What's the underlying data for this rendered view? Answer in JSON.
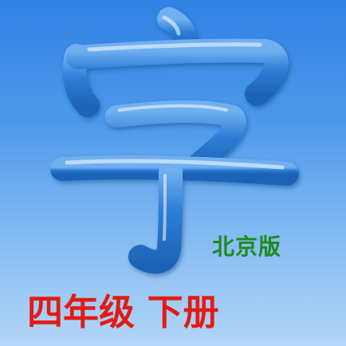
{
  "icon": {
    "character": "字",
    "edition_label": "北京版",
    "volume_label": "四年级 下册"
  },
  "colors": {
    "background_top": "#2f82e4",
    "background_bottom": "#b4d6f8",
    "character_fill": "#2d7dd6",
    "edition_text": "#1f8a1f",
    "volume_text": "#e31b14"
  }
}
